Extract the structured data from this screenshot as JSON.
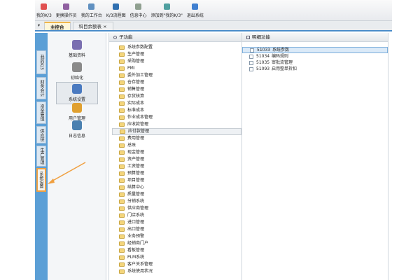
{
  "toolbar": {
    "items": [
      {
        "label": "我的K/3",
        "icon": "home-icon",
        "color": "#e05050"
      },
      {
        "label": "更换操作员",
        "icon": "user-switch-icon",
        "color": "#9060a0"
      },
      {
        "label": "我的工作台",
        "icon": "workbench-icon",
        "color": "#6090c0"
      },
      {
        "label": "K/3流程图",
        "icon": "flowchart-icon",
        "color": "#3070b0"
      },
      {
        "label": "信息中心",
        "icon": "message-icon",
        "color": "#90a090"
      },
      {
        "label": "添加到\"我的K/3\"",
        "icon": "add-favorite-icon",
        "color": "#50a0a0"
      },
      {
        "label": "退出系统",
        "icon": "exit-icon",
        "color": "#4080d0"
      }
    ]
  },
  "tabs": [
    {
      "label": "主控台"
    },
    {
      "label": "科目余额表",
      "close": "×"
    }
  ],
  "vertical_tabs": [
    "我的K/3",
    "财务会计",
    "资金管理",
    "供应链",
    "生产管理",
    "系统设置"
  ],
  "icon_panel": [
    {
      "label": "基础资料",
      "color": "#7a6fb0"
    },
    {
      "label": "初始化",
      "color": "#8a8a8a"
    },
    {
      "label": "系统设置",
      "color": "#4a7ac0"
    },
    {
      "label": "用户管理",
      "color": "#e0a030"
    },
    {
      "label": "日志信息",
      "color": "#4a80b0"
    }
  ],
  "sub_panel": {
    "title": "子功能",
    "items": [
      "系统参数配置",
      "生产管理",
      "采购管理",
      "PMI",
      "委外加工管理",
      "仓存管理",
      "销售管理",
      "存货核算",
      "实际成本",
      "标准成本",
      "作业成本管理",
      "应收款管理",
      "应付款管理",
      "费用管理",
      "总账",
      "现金管理",
      "资产管理",
      "工资管理",
      "预算管理",
      "项目管理",
      "结算中心",
      "质量管理",
      "分销系统",
      "供应商管理",
      "门店系统",
      "进口管理",
      "出口管理",
      "业务预警",
      "经销商门户",
      "看板管理",
      "PLM系统",
      "客户关系管理",
      "系统使用状况"
    ],
    "highlighted": "应付款管理"
  },
  "detail_panel": {
    "title": "明细功能",
    "items": [
      {
        "code": "51033",
        "label": "系统参数"
      },
      {
        "code": "51034",
        "label": "编码规则"
      },
      {
        "code": "51035",
        "label": "审批流管理"
      },
      {
        "code": "51093",
        "label": "启用整单折扣"
      }
    ]
  }
}
